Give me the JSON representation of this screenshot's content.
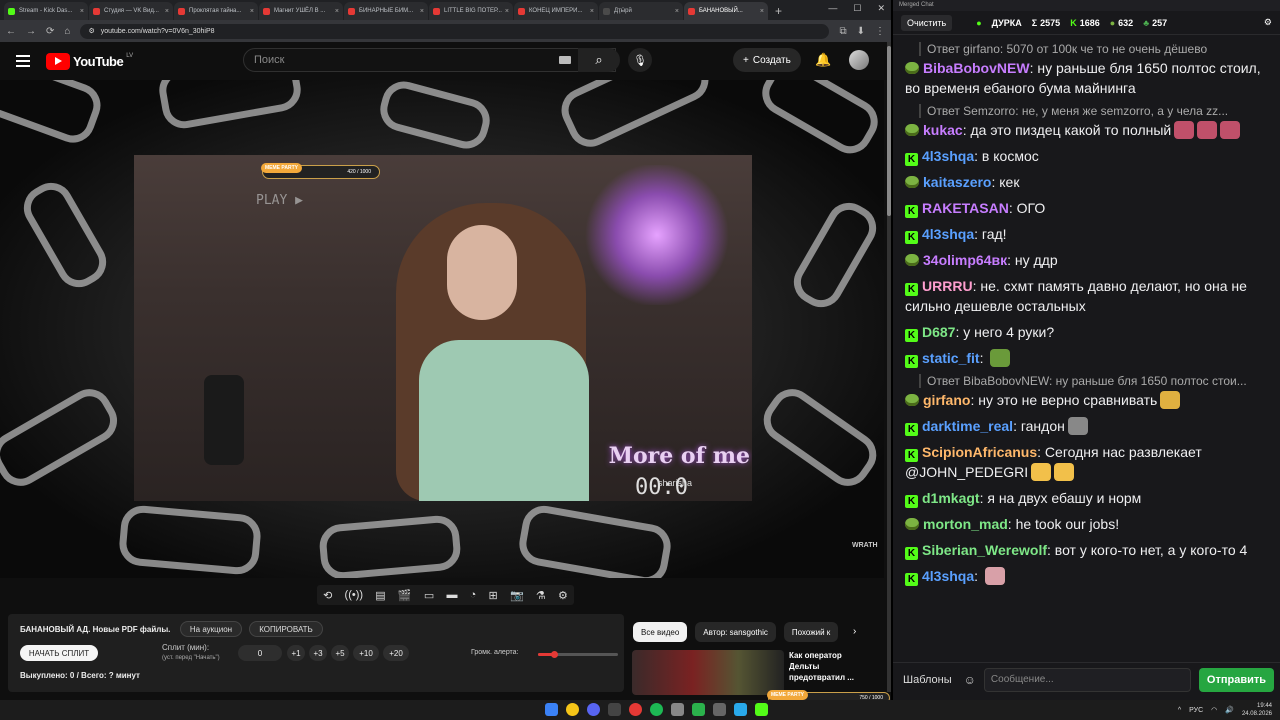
{
  "browser": {
    "tabs": [
      {
        "label": "Stream - Kick Das...",
        "color": "#53fc18"
      },
      {
        "label": "Студия — VK Вид...",
        "color": "#e53935"
      },
      {
        "label": "Проклятая тайна...",
        "color": "#e53935"
      },
      {
        "label": "Магнит УШЁЛ В ...",
        "color": "#e53935"
      },
      {
        "label": "БИНАРНЫЕ БИМ...",
        "color": "#e53935"
      },
      {
        "label": "LITTLE BIG ПОТЕР...",
        "color": "#e53935"
      },
      {
        "label": "КОНЕЦ ИМПЕРИ...",
        "color": "#e53935"
      },
      {
        "label": "Дҭӹрй",
        "color": "#4a4a4a"
      },
      {
        "label": "БАНАНОВЫЙ...",
        "color": "#e53935",
        "active": true
      }
    ],
    "url": "youtube.com/watch?v=0V6n_30hiP8"
  },
  "youtube": {
    "logo": "YouTube",
    "region": "LV",
    "search_placeholder": "Поиск",
    "create_label": "Создать"
  },
  "video": {
    "meme_party": "MEME PARTY",
    "meme_progress": "420 / 1000",
    "play_text": "PLAY ▶",
    "overlay_title": "More of me",
    "overlay_handle": "sharisha",
    "overlay_timer": "00:0",
    "watermark": "WRATH"
  },
  "panel": {
    "title": "БАНАНОВЫЙ АД. Новые PDF файлы.",
    "auction": "На аукцион",
    "copy": "КОПИРОВАТЬ",
    "start_split": "НАЧАТЬ СПЛИТ",
    "split_label": "Сплит (мин):",
    "split_hint": "(уст. перед \"Начать\")",
    "split_value": "0",
    "increments": [
      "+1",
      "+3",
      "+5",
      "+10",
      "+20"
    ],
    "alert_volume_label": "Громк. алерта:",
    "alert_volume": 0.2,
    "bought": "Выкуплено: 0 / Всего: ? минут"
  },
  "related": {
    "filters": [
      "Все видео",
      "Автор: sansgothic",
      "Похожий к"
    ],
    "video_title": "Как оператор Дельты предотвратил ..."
  },
  "meme_mini": {
    "label": "MEME PARTY",
    "progress": "750 / 1000"
  },
  "chat": {
    "window_title": "Merged Chat",
    "clear_label": "Очистить",
    "channel": "ДУРКА",
    "stats": [
      {
        "icon": "sigma",
        "value": "2575"
      },
      {
        "icon": "kick",
        "value": "1686"
      },
      {
        "icon": "pepe",
        "value": "632"
      },
      {
        "icon": "leaf",
        "value": "257"
      }
    ],
    "messages": [
      {
        "reply": "Ответ girfano: 5070 от 100к че то не очень дёшево"
      },
      {
        "platform": "pepe",
        "nick": "BibaBobovNEW",
        "color": "#c77dff",
        "text": "ну раньше бля 1650 полтос стоил, во временя ебаного бума майнинга"
      },
      {
        "reply": "Ответ Semzorro: не, у меня же semzorro, а у чела zz..."
      },
      {
        "platform": "pepe",
        "nick": "kukac",
        "color": "#c77dff",
        "text": "да это пиздец какой то полный"
      },
      {
        "platform": "kick",
        "nick": "4l3shqa",
        "color": "#5aa0ff",
        "text": "в космос"
      },
      {
        "platform": "pepe",
        "nick": "kaitaszero",
        "color": "#5aa0ff",
        "text": "кек"
      },
      {
        "platform": "kick",
        "nick": "RAKETASAN",
        "color": "#c77dff",
        "text": "ОГО"
      },
      {
        "platform": "kick",
        "nick": "4l3shqa",
        "color": "#5aa0ff",
        "text": "гад!"
      },
      {
        "platform": "pepe",
        "nick": "34olimp64вк",
        "color": "#c77dff",
        "text": "ну ддр"
      },
      {
        "platform": "kick",
        "nick": "URRRU",
        "color": "#ff9ecf",
        "text": "не. схмт память давно делают, но она не сильно дешевле остальных"
      },
      {
        "platform": "kick",
        "nick": "D687",
        "color": "#7ee787",
        "text": "у него 4 руки?"
      },
      {
        "platform": "kick",
        "nick": "static_fit",
        "color": "#5aa0ff",
        "text": ""
      },
      {
        "reply": "Ответ BibaBobovNEW: ну раньше бля 1650 полтос стои..."
      },
      {
        "platform": "pepe",
        "nick": "girfano",
        "color": "#ffb86b",
        "text": "ну это не верно сравнивать"
      },
      {
        "platform": "kick",
        "nick": "darktime_real",
        "color": "#5aa0ff",
        "text": "гандон"
      },
      {
        "platform": "kick",
        "nick": "ScipionAfricanus",
        "color": "#ffb86b",
        "text": "Сегодня нас развлекает @JOHN_PEDEGRI"
      },
      {
        "platform": "kick",
        "nick": "d1mkagt",
        "color": "#7ee787",
        "text": "я на двух ебашу и норм"
      },
      {
        "platform": "pepe",
        "nick": "morton_mad",
        "color": "#7ee787",
        "text": "he took our jobs!"
      },
      {
        "platform": "kick",
        "nick": "Siberian_Werewolf",
        "color": "#7ee787",
        "text": "вот у кого-то нет, а у кого-то 4"
      },
      {
        "platform": "kick",
        "nick": "4l3shqa",
        "color": "#5aa0ff",
        "text": ""
      }
    ],
    "templates_label": "Шаблоны",
    "input_placeholder": "Сообщение...",
    "send_label": "Отправить"
  },
  "taskbar": {
    "lang": "РУС",
    "time": "19:44",
    "date": "24.08.2026"
  }
}
